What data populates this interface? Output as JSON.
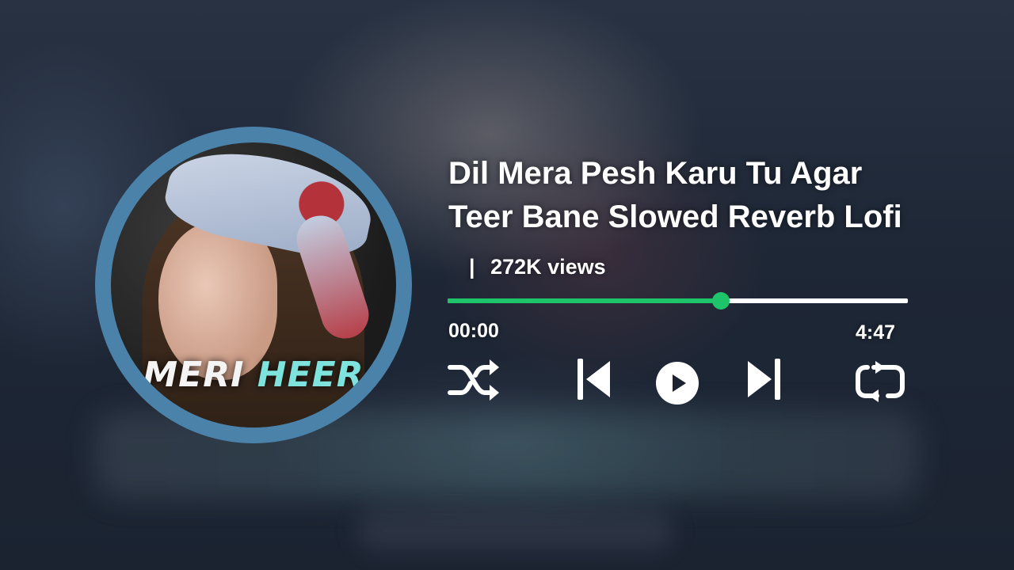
{
  "track": {
    "title_line1": "Dil Mera Pesh Karu Tu Agar",
    "title_line2": "Teer Bane Slowed Reverb Lofi",
    "separator": "|",
    "views": "272K views"
  },
  "cover": {
    "caption_word1": "MERI",
    "caption_word2": "HEER",
    "caption_color1": "#f4f4f4",
    "caption_color2": "#7de3dc",
    "ring_color": "#4a82aa"
  },
  "player": {
    "current_time": "00:00",
    "total_time": "4:47",
    "progress_fraction": 0.593,
    "progress_color": "#1ec46a",
    "track_color": "#ffffff",
    "controls": [
      "shuffle-icon",
      "previous-icon",
      "play-icon",
      "next-icon",
      "repeat-icon"
    ]
  }
}
